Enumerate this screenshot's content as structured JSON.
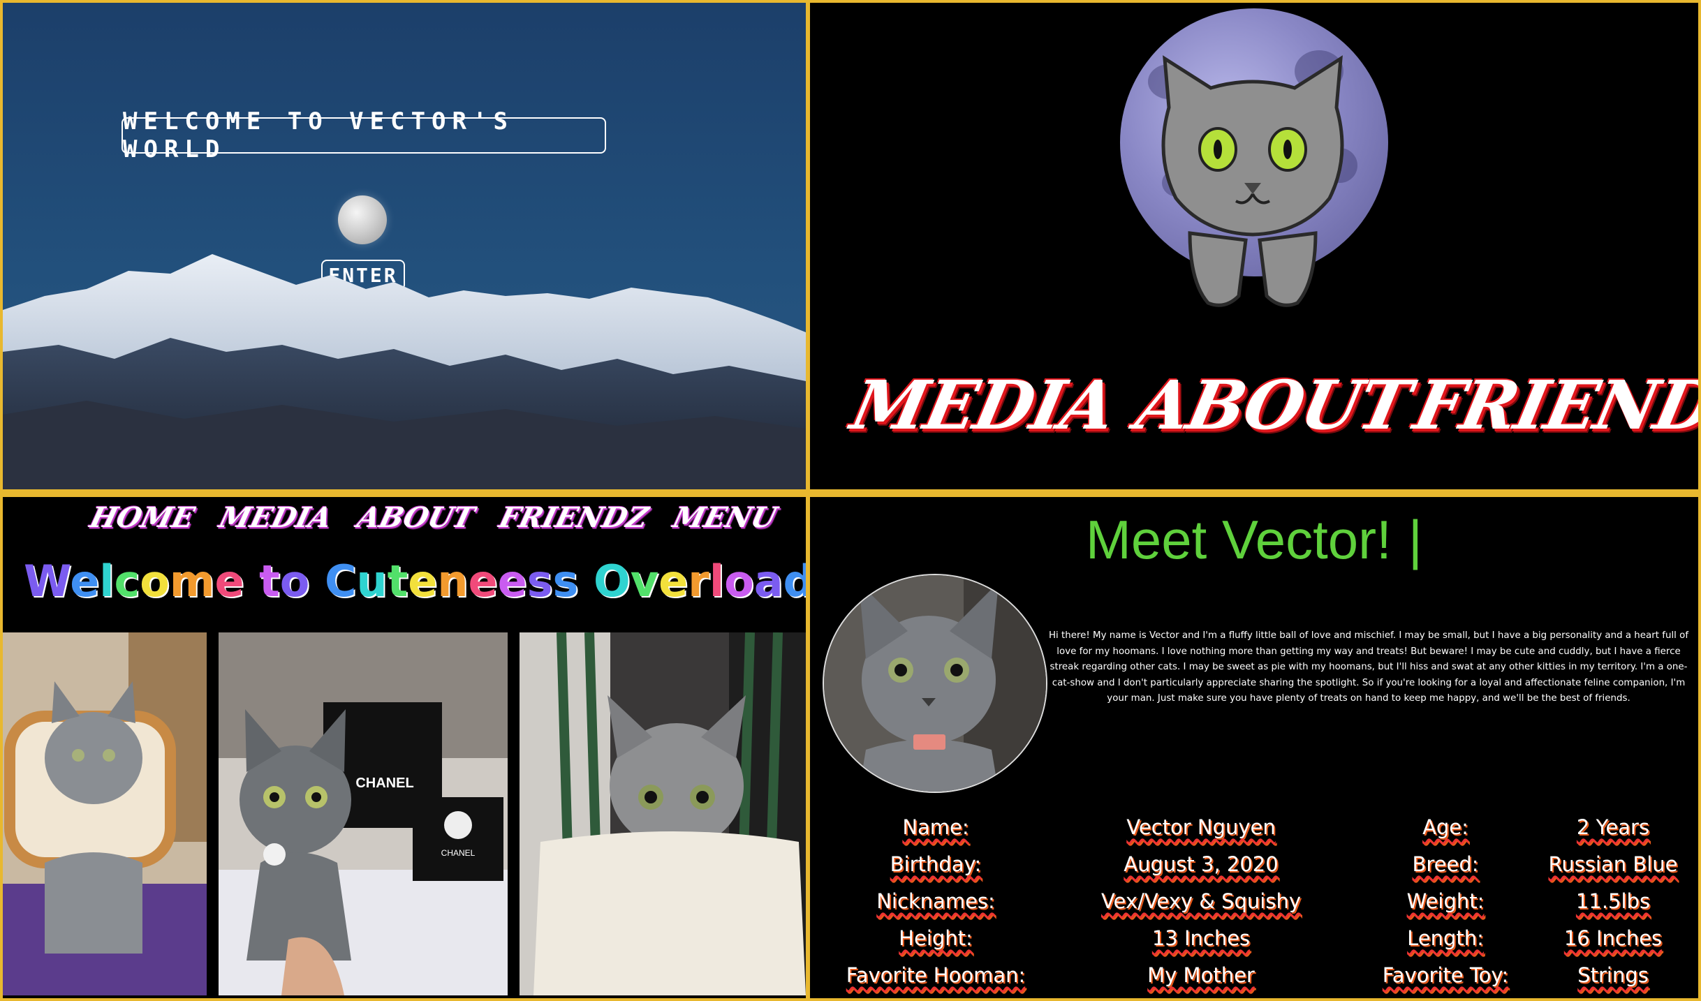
{
  "landing": {
    "welcome": "WELCOME TO VECTOR'S WORLD",
    "enter_label": "ENTER"
  },
  "menu": {
    "items": [
      "MEDIA",
      "ABOUT",
      "FRIENDZ"
    ]
  },
  "gallery": {
    "nav": [
      "HOME",
      "MEDIA",
      "ABOUT",
      "FRIENDZ",
      "MENU"
    ],
    "title": "Welcome to Cuteneess Overload!",
    "chanel_text": "CHANEL",
    "chanel_box_text": "CHANEL"
  },
  "about": {
    "title": "Meet Vector!",
    "cursor": "|",
    "bio": "Hi there! My name is Vector and I'm a fluffy little ball of love and mischief. I may be small, but I have a big personality and a heart full of love for my hoomans. I love nothing more than getting my way and treats! But beware! I may be cute and cuddly, but I have a fierce streak regarding other cats. I may be sweet as pie with my hoomans, but I'll hiss and swat at any other kitties in my territory. I'm a one-cat-show and I don't particularly appreciate sharing the spotlight. So if you're looking for a loyal and affectionate feline companion, I'm your man. Just make sure you have plenty of treats on hand to keep me happy, and we'll be the best of friends.",
    "info": [
      {
        "label1": "Name:",
        "value1": "Vector Nguyen",
        "label2": "Age:",
        "value2": "2 Years"
      },
      {
        "label1": "Birthday:",
        "value1": "August 3, 2020",
        "label2": "Breed:",
        "value2": "Russian Blue"
      },
      {
        "label1": "Nicknames:",
        "value1": "Vex/Vexy & Squishy",
        "label2": "Weight:",
        "value2": "11.5lbs"
      },
      {
        "label1": "Height:",
        "value1": "13 Inches",
        "label2": "Length:",
        "value2": "16 Inches"
      },
      {
        "label1": "Favorite Hooman:",
        "value1": "My Mother",
        "label2": "Favorite Toy:",
        "value2": "Strings"
      }
    ]
  },
  "colors": {
    "frame": "#e8b82f",
    "meet_green": "#5fd13c",
    "metal_red": "#e0161c",
    "metal_pink": "#c43acc",
    "rainbow": [
      "#7b5cf0",
      "#3f8ff2",
      "#2fd3d0",
      "#52e06a",
      "#f2e03c",
      "#f29a2e",
      "#f04a7a",
      "#c95cf0"
    ]
  }
}
